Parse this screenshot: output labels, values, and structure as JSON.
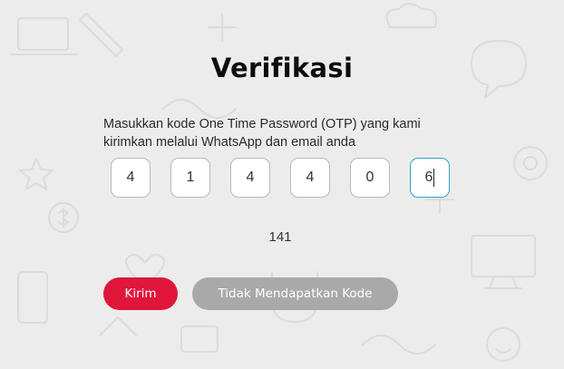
{
  "page": {
    "title": "Verifikasi",
    "description_line1": "Masukkan kode One Time Password (OTP) yang kami",
    "description_line2": "kirimkan melalui WhatsApp dan email anda"
  },
  "otp": {
    "digits": [
      "4",
      "1",
      "4",
      "4",
      "0",
      "6"
    ]
  },
  "timer": {
    "text": "141"
  },
  "buttons": {
    "send_label": "Kirim",
    "resend_label": "Tidak Mendapatkan Kode"
  },
  "colors": {
    "background": "#ececec",
    "primary": "#e0163a",
    "disabled": "#a9a9a9",
    "focus_border": "#2aa7c9"
  }
}
